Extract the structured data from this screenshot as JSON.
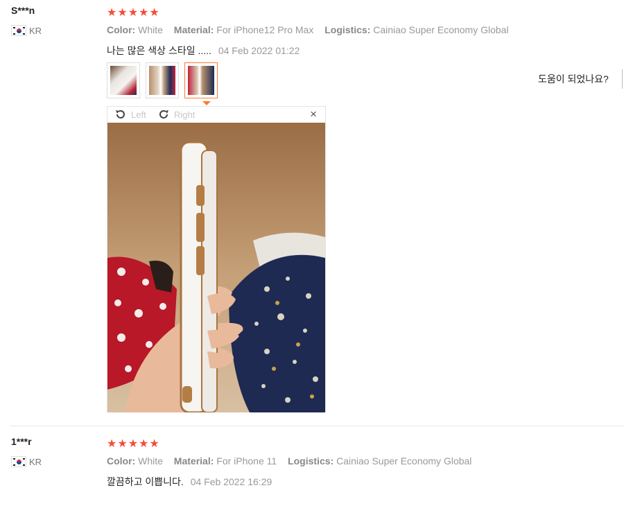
{
  "reviews": [
    {
      "username": "S***n",
      "country": "KR",
      "stars": "★★★★★",
      "attrs": {
        "color_label": "Color:",
        "color_value": "White",
        "material_label": "Material:",
        "material_value": "For iPhone12 Pro Max",
        "logistics_label": "Logistics:",
        "logistics_value": "Cainiao Super Economy Global"
      },
      "text": "나는 많은 색상 스타일 .....",
      "date": "04 Feb 2022 01:22",
      "helpful": "도움이 되었나요?",
      "viewer": {
        "rotate_left": "Left",
        "rotate_right": "Right",
        "close": "×"
      }
    },
    {
      "username": "1***r",
      "country": "KR",
      "stars": "★★★★★",
      "attrs": {
        "color_label": "Color:",
        "color_value": "White",
        "material_label": "Material:",
        "material_value": "For iPhone 11",
        "logistics_label": "Logistics:",
        "logistics_value": "Cainiao Super Economy Global"
      },
      "text": "깔끔하고 이쁩니다.",
      "date": "04 Feb 2022 16:29"
    }
  ],
  "colors": {
    "star": "#f44d3a",
    "accent": "#ff7a30"
  }
}
